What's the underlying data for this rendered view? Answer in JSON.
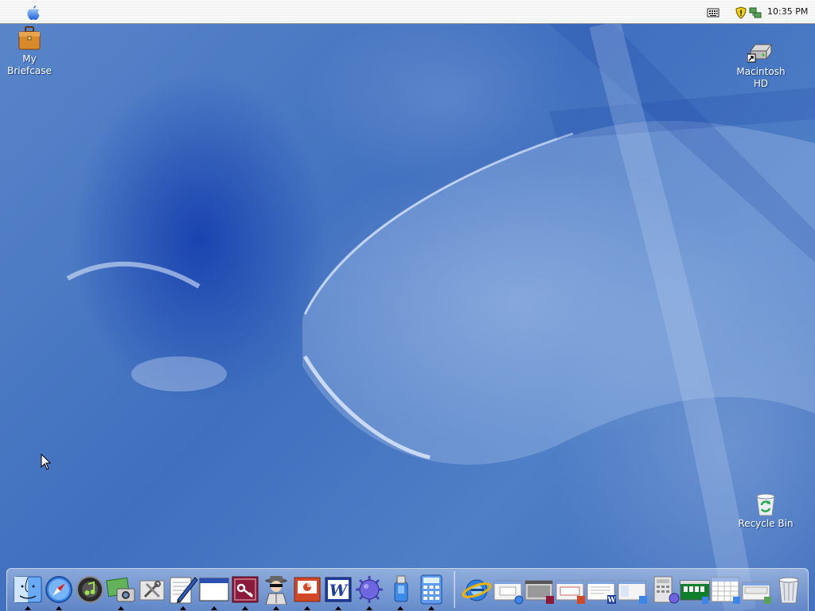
{
  "menubar": {
    "apple_icon": "apple-icon",
    "tray_icons": [
      "keyboard-icon",
      "shield-icon",
      "network-icon"
    ],
    "clock": "10:35 PM"
  },
  "desktop": {
    "icons": [
      {
        "id": "my-briefcase",
        "label_line1": "My",
        "label_line2": "Briefcase",
        "icon": "briefcase-icon"
      },
      {
        "id": "macintosh-hd",
        "label_line1": "Macintosh",
        "label_line2": "HD",
        "icon": "hard-drive-icon"
      },
      {
        "id": "recycle-bin",
        "label": "Recycle Bin",
        "icon": "recycle-bin-icon"
      }
    ]
  },
  "dock": {
    "apps": [
      {
        "name": "finder",
        "icon": "finder-icon",
        "running": true
      },
      {
        "name": "safari",
        "icon": "safari-icon",
        "running": true
      },
      {
        "name": "itunes",
        "icon": "itunes-icon",
        "running": false
      },
      {
        "name": "iphoto",
        "icon": "iphoto-icon",
        "running": true
      },
      {
        "name": "utilities",
        "icon": "tools-icon",
        "running": false
      },
      {
        "name": "textedit",
        "icon": "pencil-icon",
        "running": true
      },
      {
        "name": "window-app",
        "icon": "window-icon",
        "running": true
      },
      {
        "name": "access",
        "icon": "key-icon",
        "running": true
      },
      {
        "name": "spy-app",
        "icon": "spy-icon",
        "running": true
      },
      {
        "name": "powerpoint",
        "icon": "powerpoint-icon",
        "running": true
      },
      {
        "name": "word",
        "icon": "word-icon",
        "running": true
      },
      {
        "name": "virus-app",
        "icon": "virus-icon",
        "running": true
      },
      {
        "name": "usb-app",
        "icon": "usb-icon",
        "running": true
      },
      {
        "name": "calculator",
        "icon": "calculator-icon",
        "running": true
      }
    ],
    "minimized": [
      {
        "name": "internet-explorer",
        "icon": "internet-explorer-icon"
      },
      {
        "name": "minimized-window-1",
        "icon": "minimized-window-icon"
      },
      {
        "name": "minimized-window-2",
        "icon": "minimized-window-icon"
      },
      {
        "name": "minimized-window-3",
        "icon": "minimized-window-icon"
      },
      {
        "name": "minimized-word-window",
        "icon": "minimized-window-icon"
      },
      {
        "name": "minimized-window-5",
        "icon": "minimized-window-icon"
      },
      {
        "name": "minimized-window-6",
        "icon": "minimized-window-icon"
      },
      {
        "name": "minimized-solitaire",
        "icon": "minimized-window-icon"
      },
      {
        "name": "minimized-calendar",
        "icon": "minimized-window-icon"
      },
      {
        "name": "minimized-window-9",
        "icon": "minimized-window-icon"
      },
      {
        "name": "trash",
        "icon": "trash-icon"
      }
    ]
  }
}
